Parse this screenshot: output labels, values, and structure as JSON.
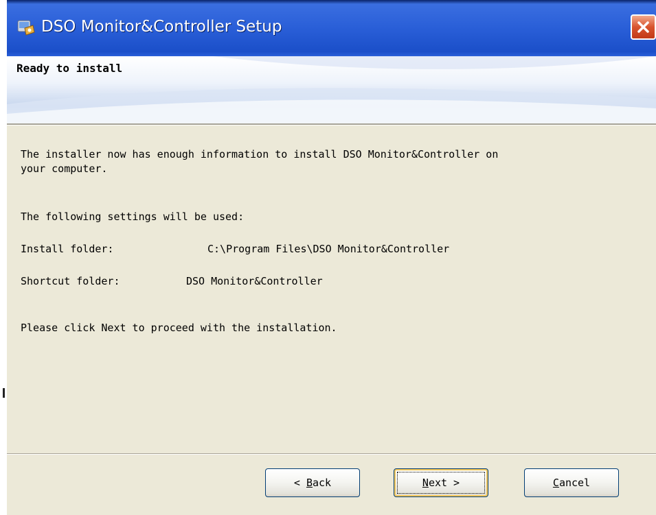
{
  "window": {
    "title": "DSO Monitor&Controller Setup",
    "icon": "installer-app-icon",
    "close_icon": "close-x-icon"
  },
  "banner": {
    "title": "Ready to install"
  },
  "body": {
    "line1": "The installer now has enough information to install DSO Monitor&Controller on",
    "line2": "your computer.",
    "settings_heading": "The following settings will be used:",
    "install_folder_label": "Install folder:",
    "install_folder_value": "C:\\Program Files\\DSO Monitor&Controller",
    "shortcut_folder_label": "Shortcut folder:",
    "shortcut_folder_value": "DSO Monitor&Controller",
    "proceed_text": "Please click Next to proceed with the installation."
  },
  "buttons": {
    "back": {
      "prefix": "< ",
      "mnemonic": "B",
      "rest": "ack"
    },
    "next": {
      "prefix": "",
      "mnemonic": "N",
      "rest": "ext >"
    },
    "cancel": {
      "prefix": "",
      "mnemonic": "C",
      "rest": "ancel"
    }
  },
  "colors": {
    "titlebar": "#2a5fd8",
    "dialog_bg": "#ece9d8",
    "close_button": "#d8542e",
    "default_button_ring": "#f6c85a"
  }
}
